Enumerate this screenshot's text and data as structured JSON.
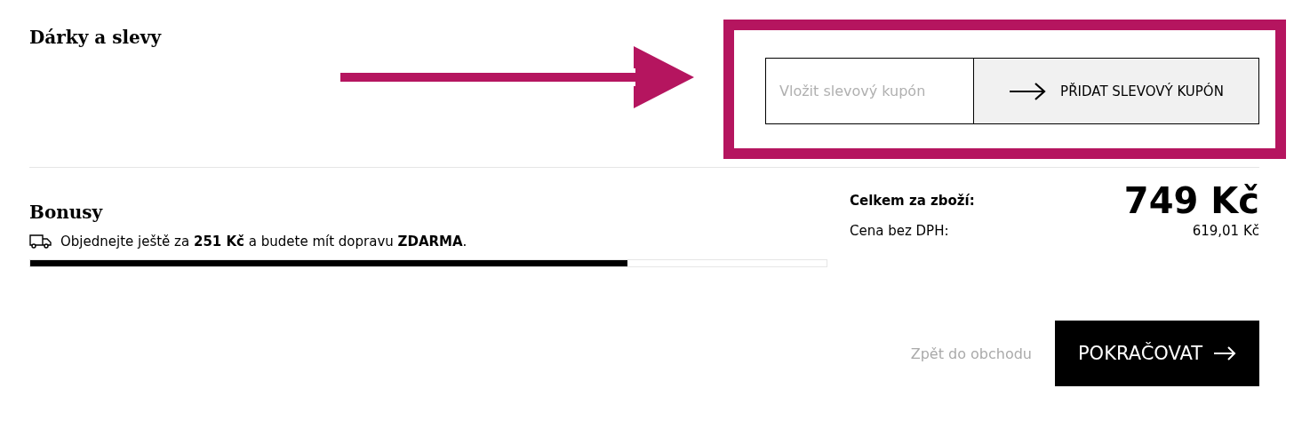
{
  "gifts": {
    "title": "Dárky a slevy",
    "coupon": {
      "placeholder": "Vložit slevový kupón",
      "button": "PŘIDAT SLEVOVÝ KUPÓN"
    }
  },
  "bonus": {
    "title": "Bonusy",
    "message": "Objednejte ještě za **251 Kč** a budete mít dopravu **ZDARMA**.",
    "level": 0.75
  },
  "totals": {
    "label": "Celkem za zboží:",
    "value": "749 Kč",
    "net_label": "Cena bez DPH:",
    "net_value": "619,01 Kč"
  },
  "actions": {
    "back": "Zpět do obchodu",
    "continue": "POKRAČOVAT"
  }
}
